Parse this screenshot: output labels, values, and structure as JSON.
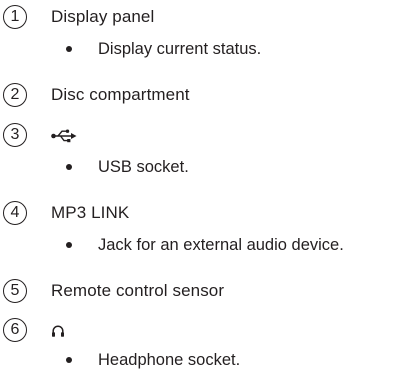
{
  "items": [
    {
      "number": "1",
      "title": "Display panel",
      "description": "Display current status."
    },
    {
      "number": "2",
      "title": "Disc compartment"
    },
    {
      "number": "3",
      "icon": "usb-icon",
      "description": "USB socket."
    },
    {
      "number": "4",
      "title": "MP3 LINK",
      "description": "Jack for an external audio device."
    },
    {
      "number": "5",
      "title": "Remote control sensor"
    },
    {
      "number": "6",
      "icon": "headphone-icon",
      "description": "Headphone socket."
    }
  ]
}
